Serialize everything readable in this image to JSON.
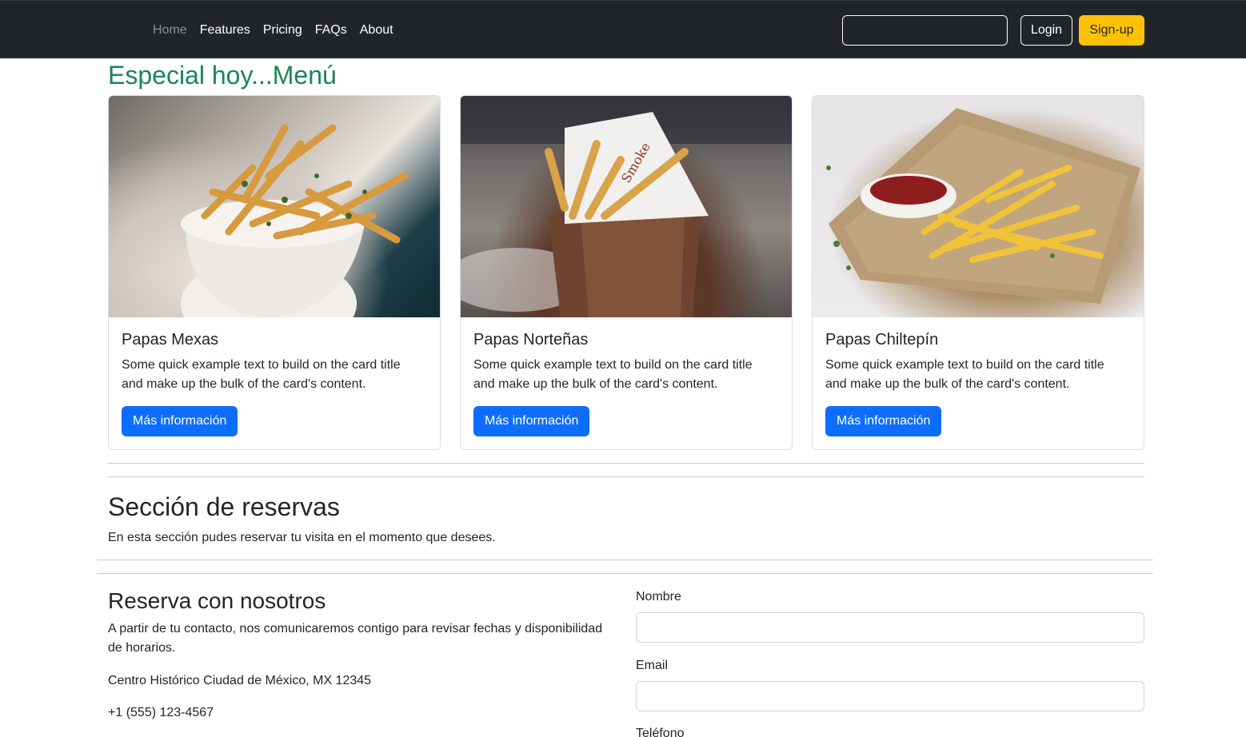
{
  "nav": {
    "links": [
      "Home",
      "Features",
      "Pricing",
      "FAQs",
      "About"
    ],
    "search_value": "",
    "login_label": "Login",
    "signup_label": "Sign-up"
  },
  "menu": {
    "title": "Especial hoy...Menú",
    "cards": [
      {
        "title": "Papas Mexas",
        "text": "Some quick example text to build on the card title and make up the bulk of the card's content.",
        "button": "Más información",
        "image": "fries-in-bowl-image"
      },
      {
        "title": "Papas Norteñas",
        "text": "Some quick example text to build on the card title and make up the bulk of the card's content.",
        "button": "Más información",
        "image": "fries-in-cup-image"
      },
      {
        "title": "Papas Chiltepín",
        "text": "Some quick example text to build on the card title and make up the bulk of the card's content.",
        "button": "Más información",
        "image": "fries-with-ketchup-image"
      }
    ]
  },
  "reservas": {
    "title": "Sección de reservas",
    "text": "En esta sección pudes reservar tu visita en el momento que desees."
  },
  "reserva_form": {
    "title": "Reserva con nosotros",
    "text": "A partir de tu contacto, nos comunicaremos contigo para revisar fechas y disponibilidad de horarios.",
    "address": "Centro Histórico Ciudad de México, MX 12345",
    "phone": "+1 (555) 123-4567",
    "fields": [
      {
        "label": "Nombre",
        "value": ""
      },
      {
        "label": "Email",
        "value": ""
      },
      {
        "label": "Teléfono",
        "value": ""
      }
    ]
  },
  "colors": {
    "navbar": "#212529",
    "accent_green": "#198754",
    "primary_blue": "#0d6efd",
    "warning_yellow": "#ffc107"
  }
}
